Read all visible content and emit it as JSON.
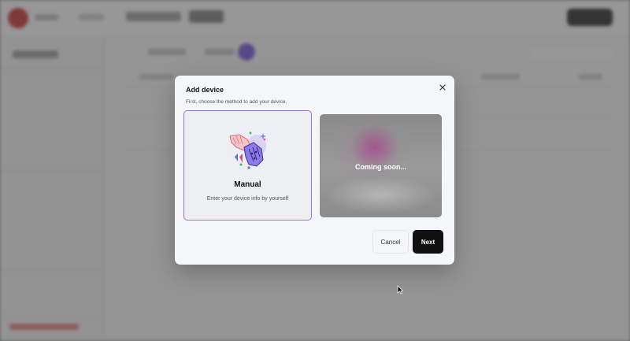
{
  "dialog": {
    "title": "Add device",
    "subtitle": "First, choose the method to add your device.",
    "close_icon": "close-icon"
  },
  "options": {
    "manual": {
      "title": "Manual",
      "description": "Enter your device info by yourself",
      "selected": true,
      "icon": "hand-cyborg-illustration",
      "accent_color": "#8e74e6"
    },
    "automatic": {
      "label": "Coming soon..."
    }
  },
  "actions": {
    "cancel_label": "Cancel",
    "next_label": "Next"
  },
  "colors": {
    "primary_button": "#111111",
    "background_dim": "#8e8e8e",
    "brand_logo": "#c62828",
    "tab_badge": "#6a4fd6"
  }
}
